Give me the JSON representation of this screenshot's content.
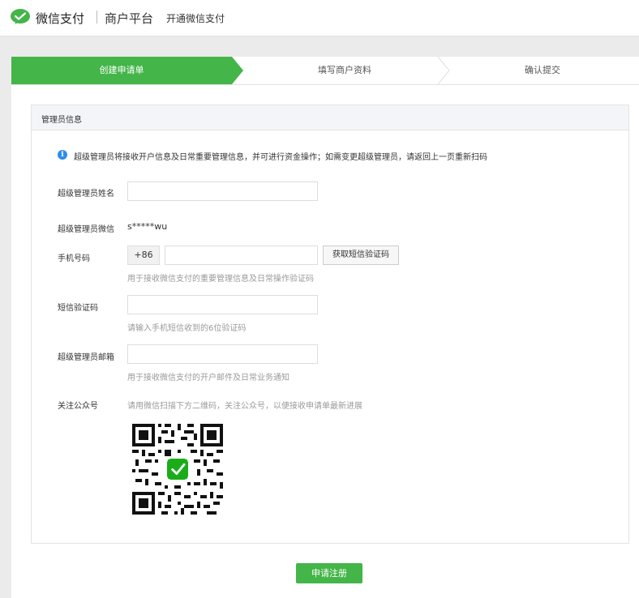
{
  "header": {
    "brand_name": "微信支付",
    "platform": "商户平台",
    "subtitle": "开通微信支付"
  },
  "steps": [
    {
      "label": "创建申请单",
      "active": true
    },
    {
      "label": "填写商户资料",
      "active": false
    },
    {
      "label": "确认提交",
      "active": false
    }
  ],
  "card": {
    "title": "管理员信息",
    "notice": "超级管理员将接收开户信息及日常重要管理信息，并可进行资金操作；如需变更超级管理员，请返回上一页重新扫码"
  },
  "form": {
    "admin_name_label": "超级管理员姓名",
    "admin_wechat_label": "超级管理员微信",
    "admin_wechat_value": "s*****wu",
    "phone_label": "手机号码",
    "phone_prefix": "+86",
    "sms_button": "获取短信验证码",
    "phone_hint": "用于接收微信支付的重要管理信息及日常操作验证码",
    "sms_code_label": "短信验证码",
    "sms_code_hint": "请输入手机短信收到的6位验证码",
    "email_label": "超级管理员邮箱",
    "email_hint": "用于接收微信支付的开户邮件及日常业务通知",
    "follow_label": "关注公众号",
    "follow_hint": "请用微信扫描下方二维码，关注公众号，以便接收申请单最新进展"
  },
  "submit_button": "申请注册",
  "colors": {
    "accent": "#44b549",
    "info": "#2e8ded"
  },
  "icons": {
    "logo": "wechat-pay-logo-icon",
    "notice": "info-icon",
    "qr": "qr-code-icon"
  }
}
